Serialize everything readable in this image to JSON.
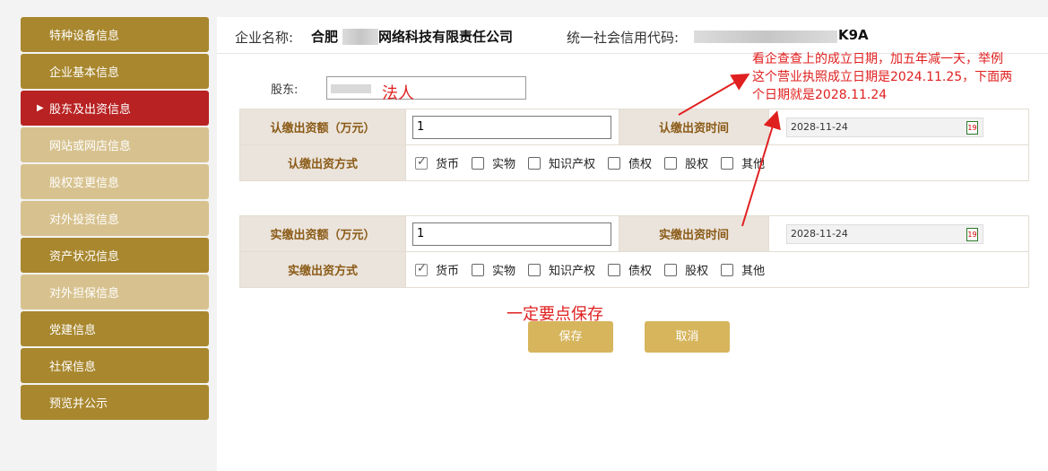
{
  "sidebar": {
    "items": [
      {
        "label": "特种设备信息",
        "style": "dark"
      },
      {
        "label": "企业基本信息",
        "style": "dark"
      },
      {
        "label": "股东及出资信息",
        "style": "active"
      },
      {
        "label": "网站或网店信息",
        "style": "light"
      },
      {
        "label": "股权变更信息",
        "style": "light"
      },
      {
        "label": "对外投资信息",
        "style": "light"
      },
      {
        "label": "资产状况信息",
        "style": "dark"
      },
      {
        "label": "对外担保信息",
        "style": "light"
      },
      {
        "label": "党建信息",
        "style": "dark"
      },
      {
        "label": "社保信息",
        "style": "dark"
      },
      {
        "label": "预览并公示",
        "style": "dark"
      }
    ],
    "active_arrow": "▶"
  },
  "header": {
    "company_label": "企业名称:",
    "company_prefix": "合肥",
    "company_suffix": "网络科技有限责任公司",
    "credit_label": "统一社会信用代码:",
    "credit_suffix": "K9A"
  },
  "shareholder": {
    "label": "股东:",
    "annotation": "法人"
  },
  "subscribed": {
    "amount_label": "认缴出资额（万元）",
    "amount_value": "1",
    "time_label": "认缴出资时间",
    "date_value": "2028-11-24",
    "method_label": "认缴出资方式"
  },
  "paid": {
    "amount_label": "实缴出资额（万元）",
    "amount_value": "1",
    "time_label": "实缴出资时间",
    "date_value": "2028-11-24",
    "method_label": "实缴出资方式"
  },
  "methods": [
    {
      "label": "货币",
      "checked": true
    },
    {
      "label": "实物",
      "checked": false
    },
    {
      "label": "知识产权",
      "checked": false
    },
    {
      "label": "债权",
      "checked": false
    },
    {
      "label": "股权",
      "checked": false
    },
    {
      "label": "其他",
      "checked": false
    }
  ],
  "calendar_icon_text": "19",
  "buttons": {
    "save": "保存",
    "cancel": "取消"
  },
  "annotations": {
    "note_line1": "看企查查上的成立日期，加五年减一天，举例",
    "note_line2": "这个营业执照成立日期是2024.11.25，下面两",
    "note_line3": "个日期就是2028.11.24",
    "save_note": "一定要点保存"
  },
  "colors": {
    "sidebar_dark": "#a8872e",
    "sidebar_light": "#d7c28f",
    "sidebar_active": "#b82222",
    "header_cell_bg": "#ebe4dc",
    "header_cell_text": "#8a5a16",
    "button_bg": "#d6b55d",
    "annotation_red": "#e02020"
  }
}
